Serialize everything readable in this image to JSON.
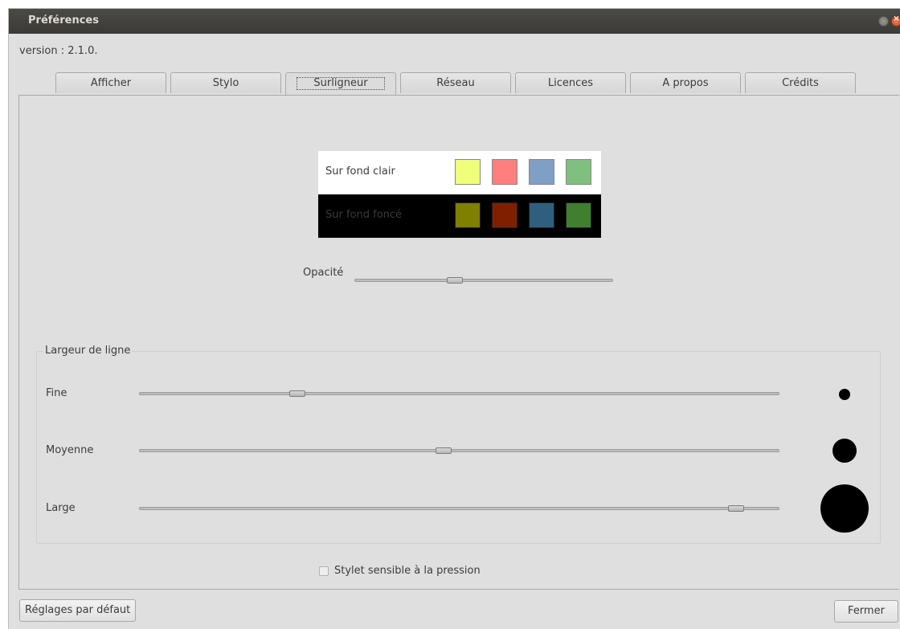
{
  "window": {
    "title": "Préférences",
    "version_text": "version : 2.1.0."
  },
  "tabs": [
    {
      "label": "Afficher"
    },
    {
      "label": "Stylo"
    },
    {
      "label": "Surligneur",
      "active": true
    },
    {
      "label": "Réseau"
    },
    {
      "label": "Licences"
    },
    {
      "label": "A propos"
    },
    {
      "label": "Crédits"
    }
  ],
  "highlighter": {
    "light_row_label": "Sur fond clair",
    "dark_row_label": "Sur fond foncé",
    "light_colors": [
      "#f0ff7a",
      "#ff7f7f",
      "#7f9fc4",
      "#7fbf7f"
    ],
    "dark_colors": [
      "#7f7f00",
      "#7f1f00",
      "#2f5f7f",
      "#3f7f2f"
    ],
    "opacity_label": "Opacité",
    "opacity_value": 0.38
  },
  "line_width": {
    "group_title": "Largeur de ligne",
    "rows": [
      {
        "label": "Fine",
        "value": 0.24
      },
      {
        "label": "Moyenne",
        "value": 0.475
      },
      {
        "label": "Large",
        "value": 0.945
      }
    ]
  },
  "pressure": {
    "label": "Stylet sensible à la pression",
    "checked": false
  },
  "buttons": {
    "defaults": "Réglages par défaut",
    "close": "Fermer"
  }
}
